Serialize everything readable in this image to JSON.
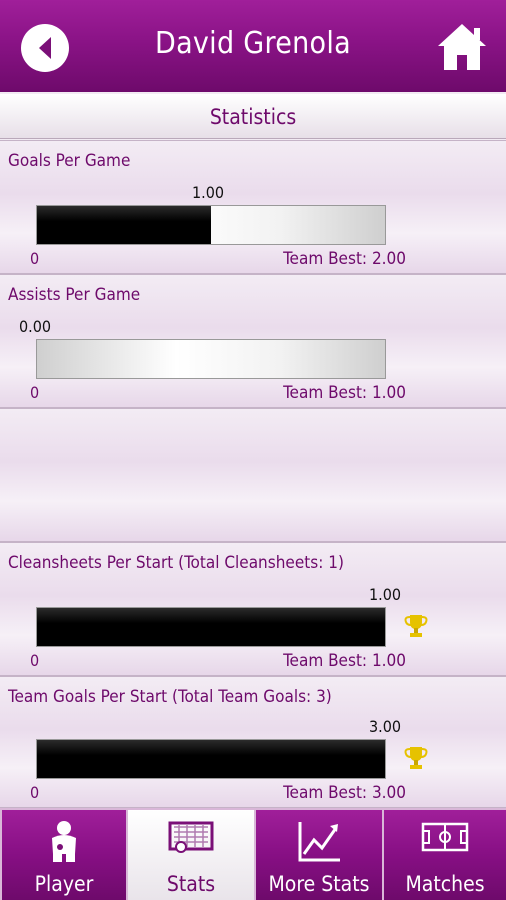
{
  "header": {
    "title": "David Grenola"
  },
  "subheader": {
    "title": "Statistics"
  },
  "stats": [
    {
      "label": "Goals Per Game",
      "value": "1.00",
      "fraction": 0.5,
      "zero": "0",
      "team_best": "Team Best: 2.00",
      "is_best": false
    },
    {
      "label": "Assists Per Game",
      "value": "0.00",
      "fraction": 0.0,
      "zero": "0",
      "team_best": "Team Best: 1.00",
      "is_best": false
    },
    {
      "label": "Cleansheets Per Start (Total Cleansheets: 1)",
      "value": "1.00",
      "fraction": 1.0,
      "zero": "0",
      "team_best": "Team Best: 1.00",
      "is_best": true
    },
    {
      "label": "Team Goals Per Start (Total Team Goals: 3)",
      "value": "3.00",
      "fraction": 1.0,
      "zero": "0",
      "team_best": "Team Best: 3.00",
      "is_best": true
    }
  ],
  "tabs": [
    {
      "label": "Player",
      "icon": "player-icon",
      "active": false
    },
    {
      "label": "Stats",
      "icon": "goal-icon",
      "active": true
    },
    {
      "label": "More Stats",
      "icon": "chart-icon",
      "active": false
    },
    {
      "label": "Matches",
      "icon": "pitch-icon",
      "active": false
    }
  ],
  "colors": {
    "accent": "#8a1386",
    "text_accent": "#6e0a6b",
    "trophy": "#e6c200"
  }
}
